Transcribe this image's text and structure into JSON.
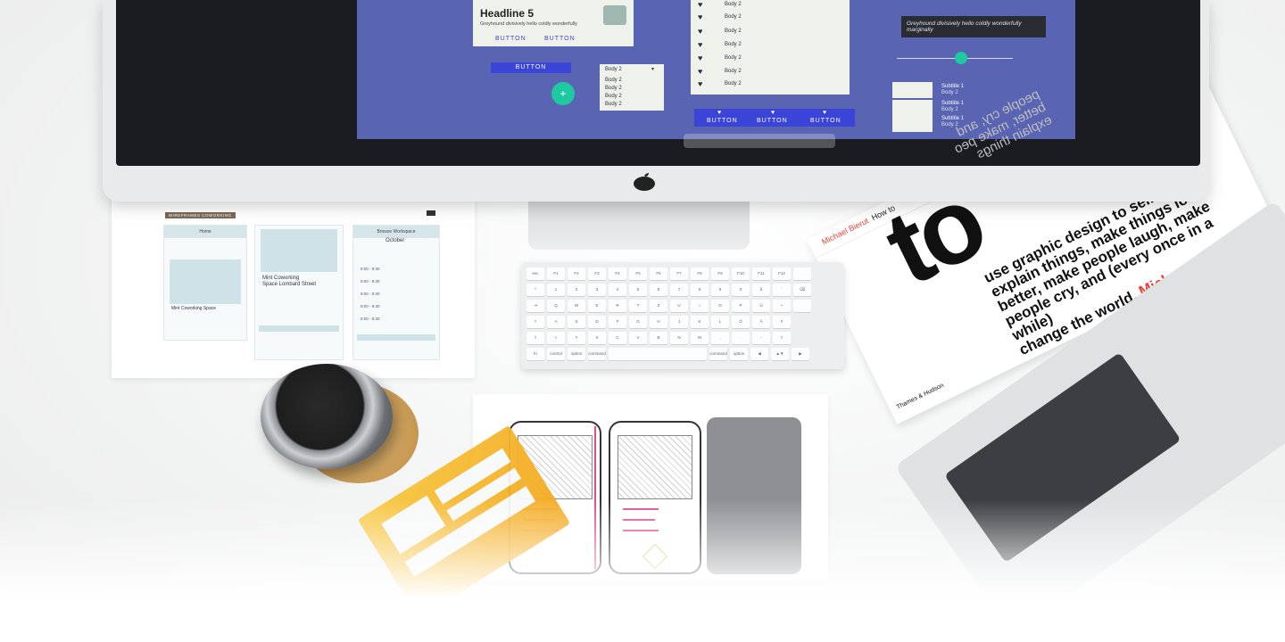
{
  "scene": {
    "description_colors": {
      "desk": "#f4f5f5",
      "screen_canvas": "#5964b3",
      "accent_red": "#e8433a",
      "button_blue": "#3a44d6",
      "fab_green": "#1ec8a0"
    }
  },
  "screen": {
    "headline": "Headline 5",
    "body_text": "Greyhound divisively hello coldly wonderfully",
    "tooltip": "Greyhound divisively hello coldly wonderfully marginally",
    "buttons": [
      "BUTTON",
      "BUTTON",
      "BUTTON"
    ],
    "bottom_buttons": [
      "BUTTON",
      "BUTTON",
      "BUTTON"
    ],
    "list_items": [
      "Body 2",
      "Body 2",
      "Body 2",
      "Body 2",
      "Body 2",
      "Body 2",
      "Body 2"
    ],
    "dropdown": {
      "selected": "Body 2",
      "options": [
        "Body 2",
        "Body 2",
        "Body 2",
        "Body 2"
      ]
    },
    "subtitles": [
      {
        "title": "Subtitle 1",
        "body": "Body 2"
      },
      {
        "title": "Subtitle 1",
        "body": "Body 2"
      },
      {
        "title": "Subtitle 1",
        "body": "Body 2"
      }
    ]
  },
  "wireframe_print": {
    "badge": "WIREFRAMES COWORKING",
    "col1_header": "Home",
    "col1_title": "Mint Coworking Space",
    "col2_title_line1": "Mint Coworking",
    "col2_title_line2": "Space Lombard Street",
    "col3_header": "Browse Workspace",
    "col3_month": "October",
    "times": [
      "9:00 - 9:30",
      "9:00 - 9:30",
      "9:00 - 9:30",
      "9:00 - 9:30",
      "9:00 - 9:30"
    ]
  },
  "keyboard": {
    "rows": [
      [
        "esc",
        "F1",
        "F2",
        "F3",
        "F4",
        "F5",
        "F6",
        "F7",
        "F8",
        "F9",
        "F10",
        "F11",
        "F12",
        ""
      ],
      [
        "^",
        "1",
        "2",
        "3",
        "4",
        "5",
        "6",
        "7",
        "8",
        "9",
        "0",
        "ß",
        "´",
        "⌫"
      ],
      [
        "⇥",
        "Q",
        "W",
        "E",
        "R",
        "T",
        "Z",
        "U",
        "I",
        "O",
        "P",
        "Ü",
        "+",
        ""
      ],
      [
        "⇪",
        "A",
        "S",
        "D",
        "F",
        "G",
        "H",
        "J",
        "K",
        "L",
        "Ö",
        "Ä",
        "#"
      ],
      [
        "⇧",
        "<",
        "Y",
        "X",
        "C",
        "V",
        "B",
        "N",
        "M",
        ",",
        ".",
        "-",
        "⇧"
      ],
      [
        "fn",
        "control",
        "option",
        "command",
        "",
        "command",
        "option",
        "◀",
        "▲▼",
        "▶"
      ]
    ]
  },
  "book": {
    "spine_author": "Michael Bierut",
    "spine_title": "How to",
    "cover_big": "to",
    "tagline_lines": [
      "use graphic design to sell things,",
      "explain things, make things look",
      "better, make people laugh, make",
      "people cry, and (every once in a while)",
      "change the world."
    ],
    "tagline_author": "Michael Bierut",
    "publisher": "Thames & Hudson",
    "mirrored_lines": [
      "people cry, and",
      "better, make peo",
      "explain things"
    ]
  }
}
